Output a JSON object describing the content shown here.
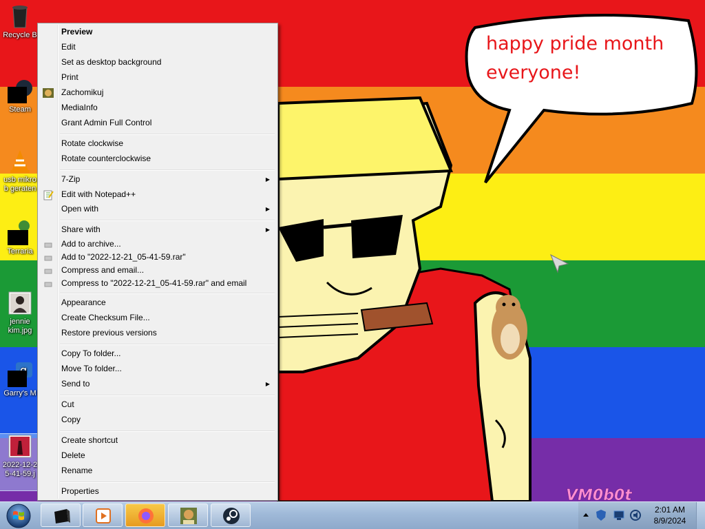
{
  "wallpaper": {
    "speech_text_line1": "happy pride month",
    "speech_text_line2": "everyone!",
    "signature": "VM0b0t",
    "stripe_colors": [
      "#e8161a",
      "#f58a1e",
      "#fdee14",
      "#1b9a36",
      "#1a55e8",
      "#762da8"
    ]
  },
  "desktop_icons": [
    {
      "label": "Recycle B",
      "icon": "recycle-bin-icon"
    },
    {
      "label": "Steam",
      "icon": "steam-icon"
    },
    {
      "label_line1": "usb mikro",
      "label_line2": "b geraten",
      "icon": "vlc-icon"
    },
    {
      "label": "Terraria",
      "icon": "terraria-icon"
    },
    {
      "label_line1": "jennie",
      "label_line2": "kim.jpg",
      "icon": "image-file-icon"
    },
    {
      "label": "Garry's M",
      "icon": "gmod-icon"
    },
    {
      "label_line1": "2022-12-2",
      "label_line2": "5-41-59.j",
      "icon": "image-file-icon"
    }
  ],
  "context_menu": {
    "preview": "Preview",
    "edit": "Edit",
    "set_background": "Set as desktop background",
    "print": "Print",
    "zachomikuj": "Zachomikuj",
    "mediainfo": "MediaInfo",
    "grant_admin": "Grant Admin Full Control",
    "rotate_cw": "Rotate clockwise",
    "rotate_ccw": "Rotate counterclockwise",
    "seven_zip": "7-Zip",
    "edit_notepad": "Edit with Notepad++",
    "open_with": "Open with",
    "share_with": "Share with",
    "add_archive": "Add to archive...",
    "add_to_rar": "Add to \"2022-12-21_05-41-59.rar\"",
    "compress_email": "Compress and email...",
    "compress_rar_email": "Compress to \"2022-12-21_05-41-59.rar\" and email",
    "appearance": "Appearance",
    "create_checksum": "Create Checksum File...",
    "restore_versions": "Restore previous versions",
    "copy_to_folder": "Copy To folder...",
    "move_to_folder": "Move To folder...",
    "send_to": "Send to",
    "cut": "Cut",
    "copy": "Copy",
    "create_shortcut": "Create shortcut",
    "delete": "Delete",
    "rename": "Rename",
    "properties": "Properties"
  },
  "taskbar": {
    "pinned": [
      "app-black-icon",
      "media-player-icon",
      "firefox-icon",
      "box-hamster-icon",
      "steam-icon"
    ],
    "clock_time": "2:01 AM",
    "clock_date": "8/9/2024"
  }
}
